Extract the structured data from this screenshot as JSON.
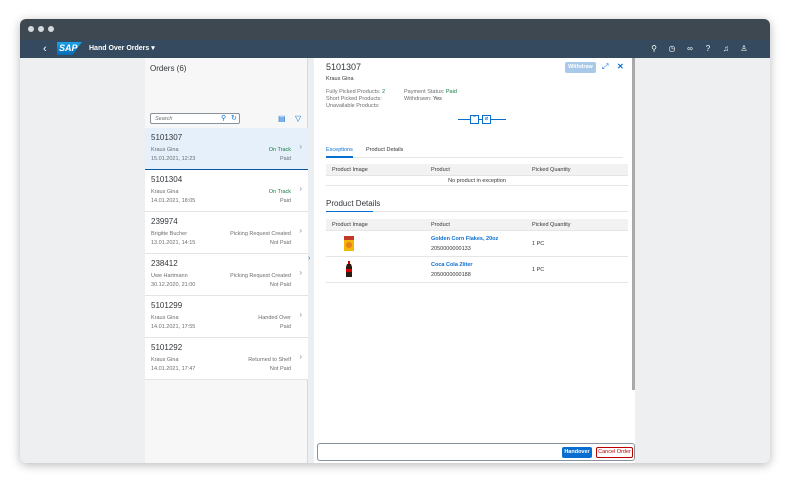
{
  "shell": {
    "back_icon": "‹",
    "logo": "SAP",
    "app_title": "Hand Over Orders ▾",
    "icons": [
      "search-icon",
      "history-icon",
      "binoculars-icon",
      "help-icon",
      "bell-icon",
      "user-icon"
    ]
  },
  "master": {
    "title": "Orders (6)",
    "search_placeholder": "Search",
    "orders": [
      {
        "id": "5101307",
        "name": "Kraus Gina",
        "date": "15.01.2021, 12:23",
        "status": "On Track",
        "payment": "Paid"
      },
      {
        "id": "5101304",
        "name": "Kraus Gina",
        "date": "14.01.2021, 18:05",
        "status": "On Track",
        "payment": "Paid"
      },
      {
        "id": "239974",
        "name": "Brigitte Bucher",
        "date": "13.01.2021, 14:15",
        "status": "Picking Request Created",
        "payment": "Not Paid"
      },
      {
        "id": "238412",
        "name": "Uwe Hartmann",
        "date": "30.12.2020, 21:00",
        "status": "Picking Request Created",
        "payment": "Not Paid"
      },
      {
        "id": "5101299",
        "name": "Kraus Gina",
        "date": "14.01.2021, 17:55",
        "status": "Handed Over",
        "payment": "Paid"
      },
      {
        "id": "5101292",
        "name": "Kraus Gina",
        "date": "14.01.2021, 17:47",
        "status": "Returned to Shelf",
        "payment": "Not Paid"
      }
    ]
  },
  "detail": {
    "order_id": "5101307",
    "customer": "Kraus Gina",
    "withdraw_label": "Withdraw",
    "fully_picked_label": "Fully Picked Products:",
    "fully_picked_value": "2",
    "short_picked_label": "Short Picked Products:",
    "unavailable_label": "Unavailable Products:",
    "payment_status_label": "Payment Status:",
    "payment_status_value": "Paid",
    "withdrawn_label": "Withdrawn:",
    "withdrawn_value": "Yes",
    "tabs": [
      "Exceptions",
      "Product Details"
    ],
    "exceptions_table": {
      "headers": [
        "Product Image",
        "Product",
        "Picked Quantity"
      ],
      "empty_text": "No product in exception"
    },
    "product_details_title": "Product Details",
    "product_table": {
      "headers": [
        "Product Image",
        "Product",
        "Picked Quantity"
      ],
      "rows": [
        {
          "name": "Golden Corn Flakes, 20oz",
          "code": "2050000000133",
          "qty": "1 PC"
        },
        {
          "name": "Coca Cola 2liter",
          "code": "2050000000188",
          "qty": "1 PC"
        }
      ]
    }
  },
  "footer": {
    "handover_label": "Handover",
    "cancel_label": "Cancel Order"
  },
  "colors": {
    "shell": "#354a5f",
    "accent": "#0a6ed1",
    "positive": "#107e3e",
    "negative": "#bb0000"
  }
}
